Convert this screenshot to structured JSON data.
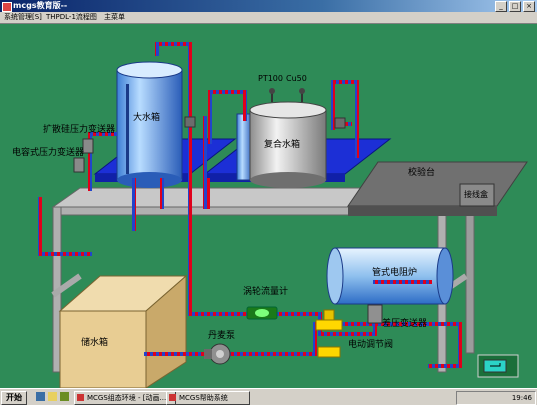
{
  "window": {
    "title": "mcgs教育版--"
  },
  "menu": {
    "items": [
      "系统管理[S]",
      "THPDL-1流程图",
      "主菜单"
    ]
  },
  "labels": {
    "big_tank": "大水箱",
    "composite_tank": "复合水箱",
    "diffused_silicon_transmitter": "扩散硅压力变送器",
    "capacitive_transmitter": "电容式压力变送器",
    "pt100": "PT100",
    "cu50": "Cu50",
    "calibration_bench": "校验台",
    "junction_box": "接线盒",
    "tubular_furnace": "管式电阻炉",
    "storage_tank": "储水箱",
    "turbine_flowmeter": "涡轮流量计",
    "pump": "丹麦泵",
    "dp_transmitter": "差压变送器",
    "electric_valve": "电动调节阀"
  },
  "taskbar": {
    "start": "开始",
    "items": [
      "MCGS组态环境 - [动画...",
      "MCGS帮助系统"
    ],
    "clock": "19:46"
  },
  "colors": {
    "background": "#2e8b57",
    "frame": "#a9a9a9",
    "platform": "#1c2fd6",
    "pipe_red": "#e0001b",
    "pipe_blue": "#2244cc"
  }
}
